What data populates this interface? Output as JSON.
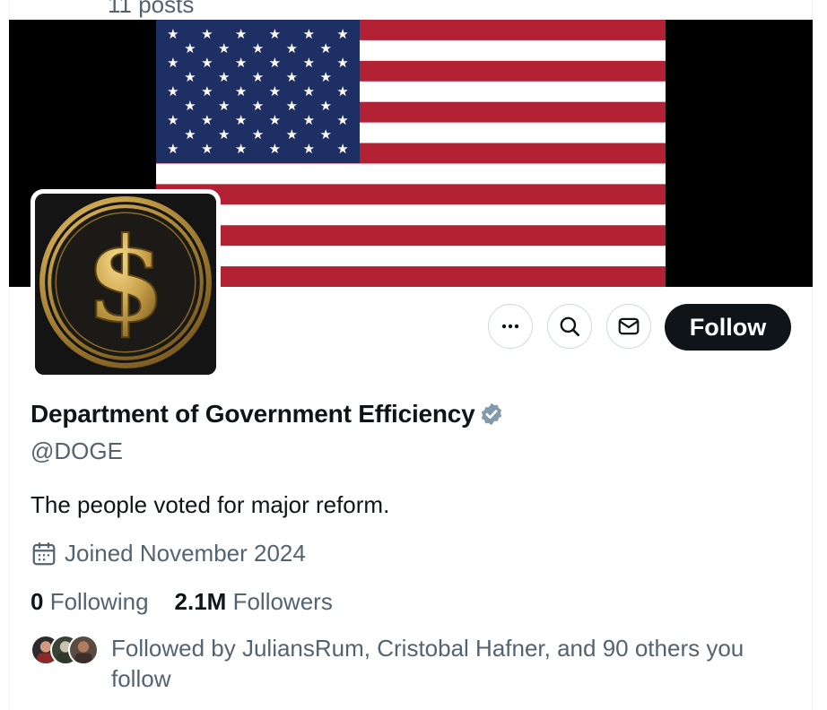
{
  "header": {
    "posts_count": "11 posts"
  },
  "profile": {
    "display_name": "Department of Government Efficiency",
    "handle": "@DOGE",
    "bio": "The people voted for major reform.",
    "joined": "Joined November 2024",
    "verified_badge_color": "#829aab"
  },
  "actions": {
    "more_icon": "more-icon",
    "search_icon": "search-icon",
    "message_icon": "message-icon",
    "follow_label": "Follow"
  },
  "stats": {
    "following_count": "0",
    "following_label": "Following",
    "followers_count": "2.1M",
    "followers_label": "Followers"
  },
  "followed_by": {
    "text": "Followed by JuliansRum, Cristobal Hafner, and 90 others you follow"
  },
  "colors": {
    "text_primary": "#0f1419",
    "text_secondary": "#536471",
    "flag_red": "#b22234",
    "flag_blue": "#1e2f63",
    "avatar_gold": "#c9a24a"
  }
}
